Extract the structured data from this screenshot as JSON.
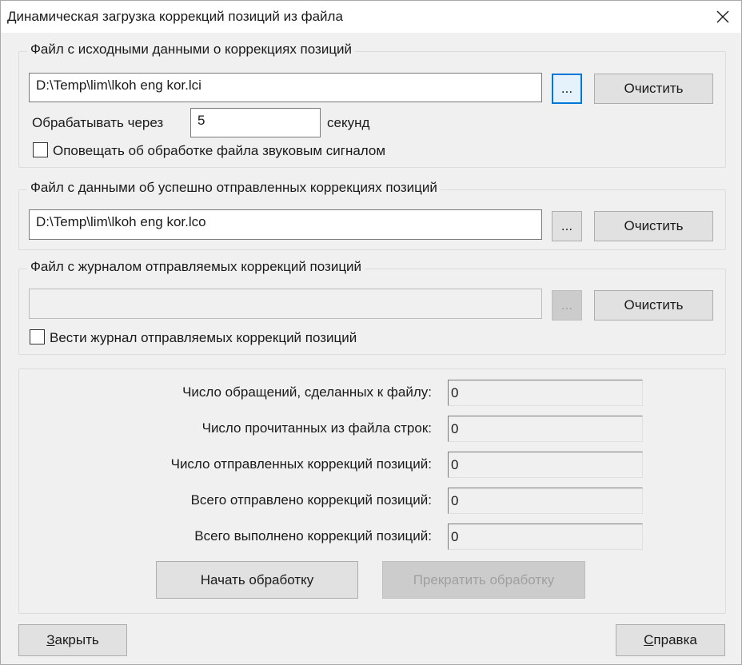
{
  "window": {
    "title": "Динамическая загрузка коррекций позиций из файла"
  },
  "source_group": {
    "legend": "Файл с исходными данными о коррекциях позиций",
    "path_value": "D:\\Temp\\lim\\lkoh eng kor.lci",
    "browse_label": "...",
    "clear_label": "Очистить",
    "interval_label": "Обрабатывать через",
    "interval_value": "5",
    "interval_unit": "секунд",
    "sound_checkbox_label": "Оповещать об обработке файла звуковым сигналом",
    "sound_checked": false
  },
  "sent_group": {
    "legend": "Файл с данными об успешно отправленных коррекциях позиций",
    "path_value": "D:\\Temp\\lim\\lkoh eng kor.lco",
    "browse_label": "...",
    "clear_label": "Очистить"
  },
  "log_group": {
    "legend": "Файл с журналом отправляемых коррекций позиций",
    "path_value": "",
    "browse_label": "...",
    "clear_label": "Очистить",
    "log_checkbox_label": "Вести журнал отправляемых коррекций позиций",
    "log_checked": false
  },
  "stats": [
    {
      "label": "Число обращений, сделанных к файлу:",
      "value": "0"
    },
    {
      "label": "Число прочитанных из файла строк:",
      "value": "0"
    },
    {
      "label": "Число отправленных коррекций позиций:",
      "value": "0"
    },
    {
      "label": "Всего отправлено коррекций позиций:",
      "value": "0"
    },
    {
      "label": "Всего выполнено коррекций позиций:",
      "value": "0"
    }
  ],
  "actions": {
    "start_label": "Начать обработку",
    "stop_label": "Прекратить обработку"
  },
  "footer": {
    "close_label_first": "З",
    "close_label_rest": "акрыть",
    "help_label_first": "С",
    "help_label_rest": "правка"
  },
  "icons": {
    "close": "close-x-icon"
  }
}
